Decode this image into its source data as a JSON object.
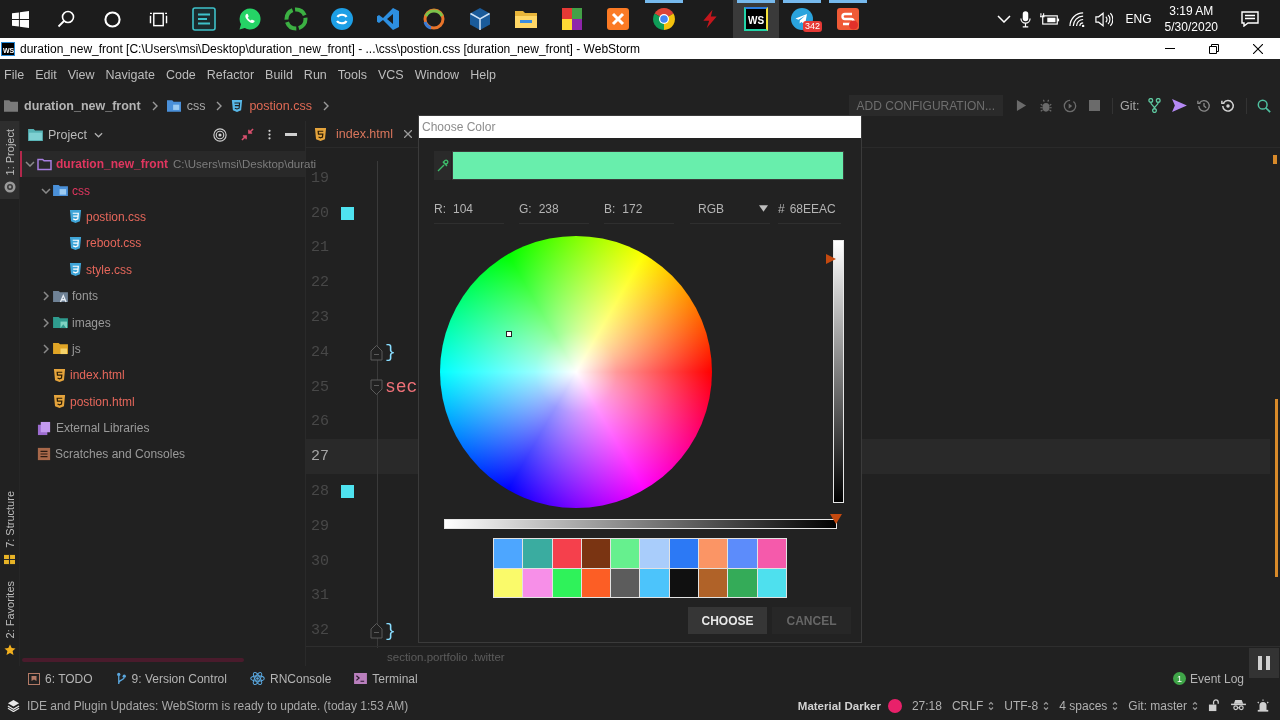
{
  "taskbar": {
    "apps": [
      {
        "kind": "lines-tile",
        "running": false,
        "selected": false
      },
      {
        "kind": "chat-bubble",
        "running": false,
        "selected": false
      },
      {
        "kind": "ring",
        "running": false,
        "selected": false
      },
      {
        "kind": "circle",
        "running": false,
        "selected": false
      },
      {
        "kind": "ribbon",
        "running": false,
        "selected": false
      },
      {
        "kind": "swirl",
        "running": false,
        "selected": false
      },
      {
        "kind": "cube",
        "running": false,
        "selected": false
      },
      {
        "kind": "folder",
        "running": false,
        "selected": false
      },
      {
        "kind": "blocks",
        "running": false,
        "selected": false
      },
      {
        "kind": "cross-tile",
        "running": false,
        "selected": false
      },
      {
        "kind": "segments",
        "running": true,
        "selected": false
      },
      {
        "kind": "lightning",
        "running": false,
        "selected": false
      },
      {
        "kind": "logo-tile",
        "label": "WS",
        "running": true,
        "selected": true
      },
      {
        "kind": "paper-plane",
        "badge": "342",
        "running": true,
        "selected": false
      },
      {
        "kind": "dot-tile",
        "running": true,
        "selected": false
      }
    ],
    "tray": {
      "language": "ENG",
      "time": "3:19 AM",
      "date": "5/30/2020"
    }
  },
  "title_bar": {
    "logo": "WS",
    "title": "duration_new_front [C:\\Users\\msi\\Desktop\\duration_new_front] - ...\\css\\postion.css [duration_new_front] - WebStorm"
  },
  "menu": [
    "File",
    "Edit",
    "View",
    "Navigate",
    "Code",
    "Refactor",
    "Build",
    "Run",
    "Tools",
    "VCS",
    "Window",
    "Help"
  ],
  "navigation_bar": {
    "breadcrumbs": [
      {
        "kind": "project",
        "label": "duration_new_front"
      },
      {
        "kind": "folder",
        "label": "css"
      },
      {
        "kind": "css-file",
        "label": "postion.css"
      }
    ],
    "run_configuration": "ADD CONFIGURATION...",
    "vcs_label": "Git:"
  },
  "tool_strip": {
    "top": [
      {
        "kind": "project",
        "label": "1: Project",
        "selected": true
      }
    ],
    "bottom": [
      {
        "kind": "structure",
        "label": "7: Structure",
        "selected": false
      },
      {
        "kind": "favorites",
        "label": "2: Favorites",
        "selected": false
      }
    ]
  },
  "project_panel": {
    "title": "Project",
    "tree": [
      {
        "kind": "root",
        "label": "duration_new_front",
        "path": "C:\\Users\\msi\\Desktop\\durati",
        "unversioned": true,
        "selected": true,
        "expanded": true,
        "children": [
          {
            "kind": "css-folder",
            "label": "css",
            "unversioned": true,
            "selected": false,
            "expanded": true,
            "children": [
              {
                "kind": "css-file",
                "label": "postion.css",
                "unversioned": true,
                "selected": false
              },
              {
                "kind": "css-file",
                "label": "reboot.css",
                "unversioned": true,
                "selected": false
              },
              {
                "kind": "css-file",
                "label": "style.css",
                "unversioned": true,
                "selected": false
              }
            ]
          },
          {
            "kind": "fonts-folder",
            "label": "fonts",
            "unversioned": false,
            "selected": false,
            "expanded": false
          },
          {
            "kind": "images-folder",
            "label": "images",
            "unversioned": false,
            "selected": false,
            "expanded": false
          },
          {
            "kind": "js-folder",
            "label": "js",
            "unversioned": false,
            "selected": false,
            "expanded": false
          },
          {
            "kind": "html-file",
            "label": "index.html",
            "unversioned": true,
            "selected": false
          },
          {
            "kind": "html-file",
            "label": "postion.html",
            "unversioned": true,
            "selected": false
          }
        ]
      },
      {
        "kind": "libraries",
        "label": "External Libraries",
        "unversioned": false,
        "selected": false
      },
      {
        "kind": "scratches",
        "label": "Scratches and Consoles",
        "unversioned": false,
        "selected": false
      }
    ]
  },
  "editor": {
    "tabs": [
      {
        "kind": "html-file",
        "label": "index.html",
        "selected": false
      }
    ],
    "lines": [
      {
        "number": "19",
        "kind": "plain",
        "current": false
      },
      {
        "number": "20",
        "kind": "plain",
        "current": false,
        "color": "#4fe3f0"
      },
      {
        "number": "21",
        "kind": "plain",
        "current": false
      },
      {
        "number": "22",
        "kind": "plain",
        "current": false
      },
      {
        "number": "23",
        "kind": "plain",
        "current": false
      },
      {
        "number": "24",
        "kind": "fold-end",
        "current": false,
        "code": {
          "kind": "punctuation",
          "text": "}"
        }
      },
      {
        "number": "25",
        "kind": "fold-start",
        "current": false,
        "code": {
          "kind": "selector",
          "text": "sec"
        }
      },
      {
        "number": "26",
        "kind": "plain",
        "current": false
      },
      {
        "number": "27",
        "kind": "plain",
        "current": true
      },
      {
        "number": "28",
        "kind": "plain",
        "current": false,
        "color": "#4fe3f0"
      },
      {
        "number": "29",
        "kind": "plain",
        "current": false
      },
      {
        "number": "30",
        "kind": "plain",
        "current": false
      },
      {
        "number": "31",
        "kind": "plain",
        "current": false
      },
      {
        "number": "32",
        "kind": "fold-end",
        "current": false,
        "code": {
          "kind": "punctuation",
          "text": "}"
        }
      }
    ],
    "breadcrumb": "section.portfolio .twitter"
  },
  "dialog": {
    "title": "Choose Color",
    "preview": {
      "color": "#68eeac"
    },
    "channels": [
      {
        "label": "R:",
        "value": "104"
      },
      {
        "label": "G:",
        "value": "238"
      },
      {
        "label": "B:",
        "value": "172"
      }
    ],
    "mode": "RGB",
    "hex": {
      "label": "#",
      "value": "68EEAC"
    },
    "brightness": {
      "level": 0.93
    },
    "opacity": {
      "level": 1
    },
    "swatches": [
      {
        "color": "#4da6ff"
      },
      {
        "color": "#3aaca0"
      },
      {
        "color": "#f5404c"
      },
      {
        "color": "#7a3412"
      },
      {
        "color": "#66f08e"
      },
      {
        "color": "#a9cdfb"
      },
      {
        "color": "#2c79f5"
      },
      {
        "color": "#fb9565"
      },
      {
        "color": "#5c8cfb"
      },
      {
        "color": "#f55aab"
      },
      {
        "color": "#fafa6a"
      },
      {
        "color": "#f78fe8"
      },
      {
        "color": "#2ff25a"
      },
      {
        "color": "#fc5e25"
      },
      {
        "color": "#5c5c5c"
      },
      {
        "color": "#4cc4fb"
      },
      {
        "color": "#101010"
      },
      {
        "color": "#b06228"
      },
      {
        "color": "#34ab58"
      },
      {
        "color": "#4ee0ee"
      }
    ],
    "buttons": [
      {
        "kind": "confirm",
        "label": "CHOOSE"
      },
      {
        "kind": "cancel",
        "label": "CANCEL"
      }
    ]
  },
  "tool_windows": {
    "tabs": [
      {
        "kind": "todo",
        "label": "6: TODO"
      },
      {
        "kind": "vcs",
        "label": "9: Version Control"
      },
      {
        "kind": "react",
        "label": "RNConsole"
      },
      {
        "kind": "terminal",
        "label": "Terminal"
      }
    ],
    "event_log": {
      "badge": "1",
      "label": "Event Log"
    }
  },
  "status_bar": {
    "message": "IDE and Plugin Updates: WebStorm is ready to update. (today 1:53 AM)",
    "widgets": [
      {
        "kind": "theme",
        "label": "Material Darker",
        "color": "#e8216a"
      },
      {
        "kind": "plain",
        "label": "27:18"
      },
      {
        "kind": "select",
        "label": "CRLF"
      },
      {
        "kind": "select",
        "label": "UTF-8"
      },
      {
        "kind": "select",
        "label": "4 spaces"
      },
      {
        "kind": "select",
        "label": "Git: master"
      }
    ]
  }
}
